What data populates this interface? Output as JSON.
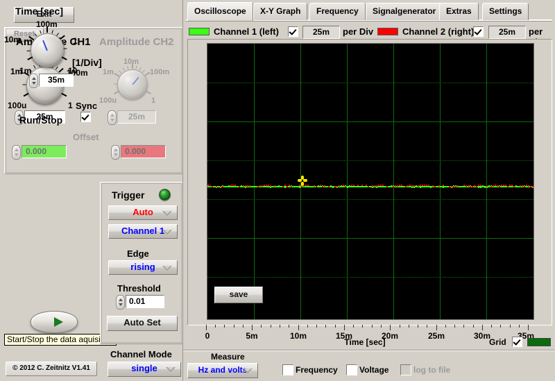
{
  "window": {
    "exit_label": "Exit",
    "copyright": "© 2012  C. Zeitnitz V1.41",
    "tooltip": "Start/Stop the data aquisition"
  },
  "amplitude": {
    "ch1_title": "Amplitude CH1",
    "ch2_title": "Amplitude CH2",
    "per_div_unit": "[1/Div]",
    "knob_labels": [
      "1m",
      "10m",
      "100m",
      "1",
      "100u"
    ],
    "ch1_value": "25m",
    "ch2_value": "25m",
    "sync_label": "Sync",
    "sync_checked": true,
    "offset_label": "Offset",
    "offset_ch1": "0.000",
    "offset_ch2": "0.000",
    "offset_reset_label": "Reset",
    "ch1_offset_color": "#7bec5c",
    "ch2_offset_color": "#e8787e"
  },
  "time": {
    "title": "Time [sec]",
    "knob_labels": [
      "1m",
      "10m",
      "100m",
      "1",
      "10"
    ],
    "value": "35m",
    "runstop_label": "Run/Stop"
  },
  "trigger": {
    "title": "Trigger",
    "led_color": "#2e9c2e",
    "mode": "Auto",
    "mode_color": "#ff0000",
    "source": "Channel 1",
    "source_color": "#0000ff",
    "edge_label": "Edge",
    "edge": "rising",
    "edge_color": "#0000ff",
    "threshold_label": "Threshold",
    "threshold": "0.01",
    "autoset_label": "Auto Set"
  },
  "channel_mode": {
    "label": "Channel Mode",
    "value": "single",
    "value_color": "#0000ff"
  },
  "tabs": [
    {
      "label": "Oscilloscope",
      "active": true
    },
    {
      "label": "X-Y Graph",
      "active": false
    },
    {
      "label": "Frequency",
      "active": false
    },
    {
      "label": "Signalgenerator",
      "active": false
    },
    {
      "label": "Extras",
      "active": false
    },
    {
      "label": "Settings",
      "active": false
    }
  ],
  "channels": {
    "ch1_label": "Channel 1 (left)",
    "ch1_color": "#39ff14",
    "ch1_enabled": true,
    "ch1_div": "25m",
    "ch1_per_div": "per Div",
    "ch2_label": "Channel 2 (right)",
    "ch2_color": "#ff0000",
    "ch2_enabled": true,
    "ch2_div": "25m",
    "ch2_per_div": "per Div"
  },
  "scope": {
    "save_label": "save",
    "grid_label": "Grid",
    "grid_checked": true,
    "grid_color": "#0c6b0c",
    "xaxis_title": "Time [sec]"
  },
  "measure": {
    "label": "Measure",
    "mode": "Hz and volts",
    "mode_color": "#0000ff",
    "frequency_label": "Frequency",
    "frequency_checked": false,
    "voltage_label": "Voltage",
    "voltage_checked": false,
    "log_label": "log to file",
    "log_checked": false,
    "log_disabled": true
  },
  "chart_data": {
    "type": "line",
    "title": "",
    "xlabel": "Time [sec]",
    "ylabel": "",
    "xlim": [
      0,
      0.035
    ],
    "xtick_labels": [
      "0",
      "5m",
      "10m",
      "15m",
      "20m",
      "25m",
      "30m",
      "35m"
    ],
    "xtick_values": [
      0,
      0.005,
      0.01,
      0.015,
      0.02,
      0.025,
      0.03,
      0.035
    ],
    "grid": true,
    "grid_color": "#0c6b0c",
    "background": "#000000",
    "vertical_divisions": 7,
    "horizontal_divisions": 8,
    "series": [
      {
        "name": "Channel 1 (left)",
        "color": "#39ff14",
        "volts_per_div": "25m",
        "level": 0.0,
        "shape": "flat-noise"
      },
      {
        "name": "Channel 2 (right)",
        "color": "#ff0000",
        "volts_per_div": "25m",
        "level": 0.0,
        "shape": "flat-noise"
      }
    ],
    "cursor": {
      "x": 0.0097,
      "y": 0.004,
      "color": "#ffe400",
      "marker": "four-petal"
    }
  }
}
